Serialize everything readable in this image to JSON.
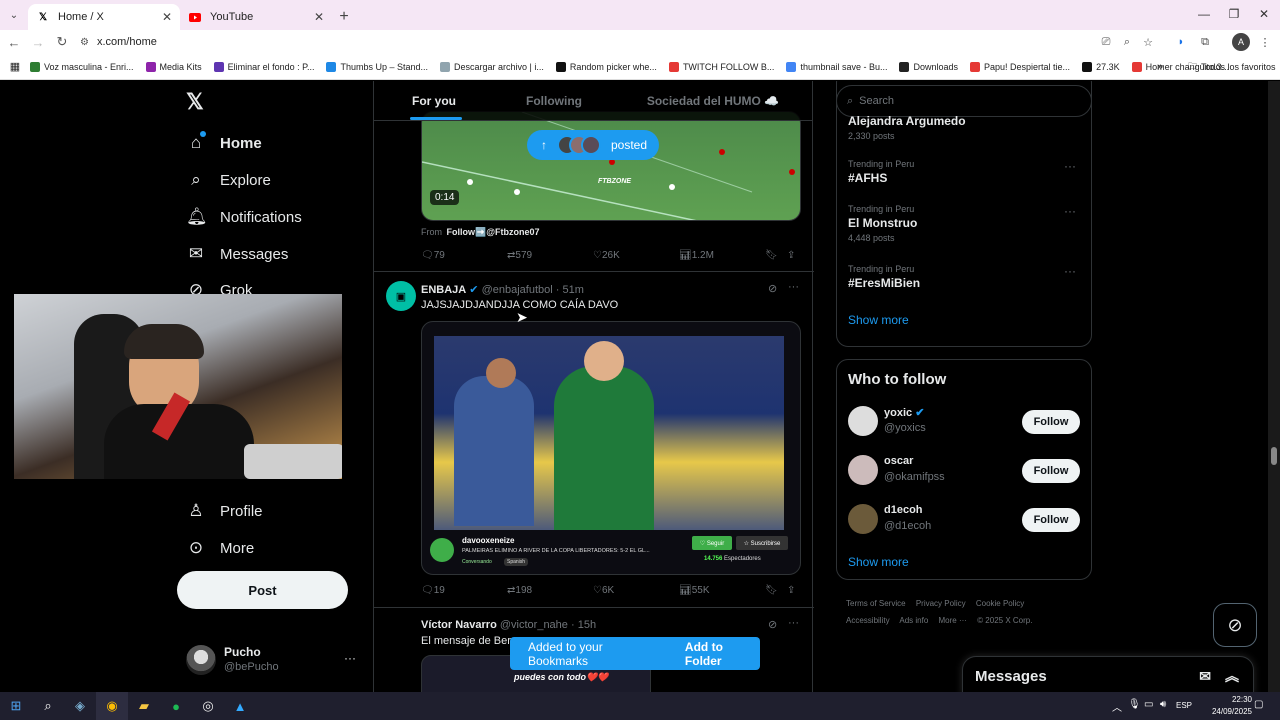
{
  "browser": {
    "tabs": [
      {
        "title": "Home / X",
        "active": true,
        "icon": "x-logo-icon"
      },
      {
        "title": "YouTube",
        "active": false,
        "icon": "youtube-icon"
      }
    ],
    "url": "x.com/home",
    "bookmarks": [
      {
        "label": "Voz masculina - Enri...",
        "color": "#2e7d32"
      },
      {
        "label": "Media Kits",
        "color": "#8e24aa"
      },
      {
        "label": "Eliminar el fondo : P...",
        "color": "#5e35b1"
      },
      {
        "label": "Thumbs Up – Stand...",
        "color": "#1e88e5"
      },
      {
        "label": "Descargar archivo | i...",
        "color": "#90a4ae"
      },
      {
        "label": "Random picker whe...",
        "color": "#111111"
      },
      {
        "label": "TWITCH FOLLOW B...",
        "color": "#e53935"
      },
      {
        "label": "thumbnail save - Bu...",
        "color": "#4285f4"
      },
      {
        "label": "Downloads",
        "color": "#222222"
      },
      {
        "label": "Papu! Despiertal tie...",
        "color": "#e53935"
      },
      {
        "label": "27.3K",
        "color": "#111111"
      },
      {
        "label": "Homer changuito.3...",
        "color": "#e53935"
      }
    ],
    "all_bookmarks": "Todos los favoritos"
  },
  "nav": {
    "items": [
      {
        "label": "Home",
        "icon": "home-icon"
      },
      {
        "label": "Explore",
        "icon": "search-icon"
      },
      {
        "label": "Notifications",
        "icon": "bell-icon"
      },
      {
        "label": "Messages",
        "icon": "mail-icon"
      },
      {
        "label": "Grok",
        "icon": "grok-icon"
      },
      {
        "label": "Profile",
        "icon": "person-icon"
      },
      {
        "label": "More",
        "icon": "more-circle-icon"
      }
    ],
    "post_label": "Post",
    "account": {
      "name": "Pucho",
      "handle": "@bePucho"
    }
  },
  "feed": {
    "tabs": [
      "For you",
      "Following",
      "Sociedad del HUMO ☁️"
    ],
    "posted_pill": "posted",
    "tweet1": {
      "duration": "0:14",
      "watermark": "FTBZONE",
      "from_label": "From",
      "from_user": "Follow➡️@Ftbzone07",
      "replies": "79",
      "reposts": "579",
      "likes": "26K",
      "views": "1.2M"
    },
    "tweet2": {
      "name": "ENBAJA",
      "handle": "@enbajafutbol",
      "time": "· 51m",
      "text": "JAJSJAJDJANDJJA COMO CAÍA DAVO",
      "stream_user": "davooxeneize",
      "stream_title": "PALMEIRAS ELIMINO A RIVER DE LA COPA LIBERTADORES: 5-2 EL GL...",
      "stream_tag1": "Conversando",
      "stream_tag2": "Spanish",
      "follow_btn": "♡ Seguir",
      "sub_btn": "☆ Suscribirse",
      "viewers": "14.756",
      "viewers_label": "Espectadores",
      "replies": "19",
      "reposts": "198",
      "likes": "6K",
      "views": "55K"
    },
    "tweet3": {
      "name": "Víctor Navarro",
      "handle": "@victor_nahe",
      "time": "· 15h",
      "text": "El mensaje de Berr",
      "media_text": "puedes con todo❤️❤️"
    }
  },
  "right": {
    "search_placeholder": "Search",
    "trends": [
      {
        "meta": "",
        "name": "Alejandra Argumedo",
        "posts": "2,330 posts"
      },
      {
        "meta": "Trending in Peru",
        "name": "#AFHS",
        "posts": ""
      },
      {
        "meta": "Trending in Peru",
        "name": "El Monstruo",
        "posts": "4,448 posts"
      },
      {
        "meta": "Trending in Peru",
        "name": "#EresMiBien",
        "posts": ""
      }
    ],
    "show_more": "Show more",
    "who_to_follow": "Who to follow",
    "suggestions": [
      {
        "name": "yoxic",
        "handle": "@yoxics",
        "verified": true
      },
      {
        "name": "oscar",
        "handle": "@okamifpss",
        "verified": false
      },
      {
        "name": "d1ecoh",
        "handle": "@d1ecoh",
        "verified": false
      }
    ],
    "follow_label": "Follow",
    "footer": [
      "Terms of Service",
      "Privacy Policy",
      "Cookie Policy",
      "Accessibility",
      "Ads info",
      "More ···",
      "© 2025 X Corp."
    ]
  },
  "toast": {
    "message": "Added to your Bookmarks",
    "action": "Add to Folder"
  },
  "messages_drawer": "Messages",
  "taskbar": {
    "lang": "ESP",
    "time": "22:30",
    "date": "24/09/2025"
  }
}
